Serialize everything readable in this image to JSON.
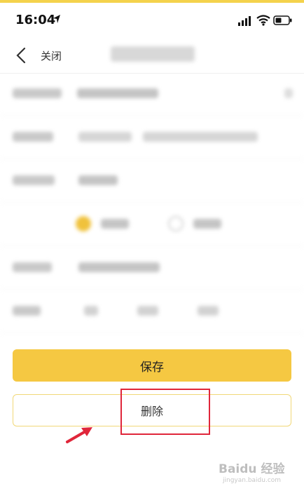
{
  "status_bar": {
    "time": "16:04",
    "icons": [
      "location-arrow-icon",
      "signal-icon",
      "wifi-icon",
      "battery-icon"
    ]
  },
  "nav": {
    "back_icon": "chevron-left-icon",
    "close_label": "关闭"
  },
  "buttons": {
    "save_label": "保存",
    "delete_label": "删除"
  },
  "colors": {
    "accent": "#f5c842",
    "delete_border": "#f1d878",
    "highlight": "#e0263a"
  },
  "watermark": {
    "brand": "Baidu 经验",
    "site": "jingyan.baidu.com"
  }
}
